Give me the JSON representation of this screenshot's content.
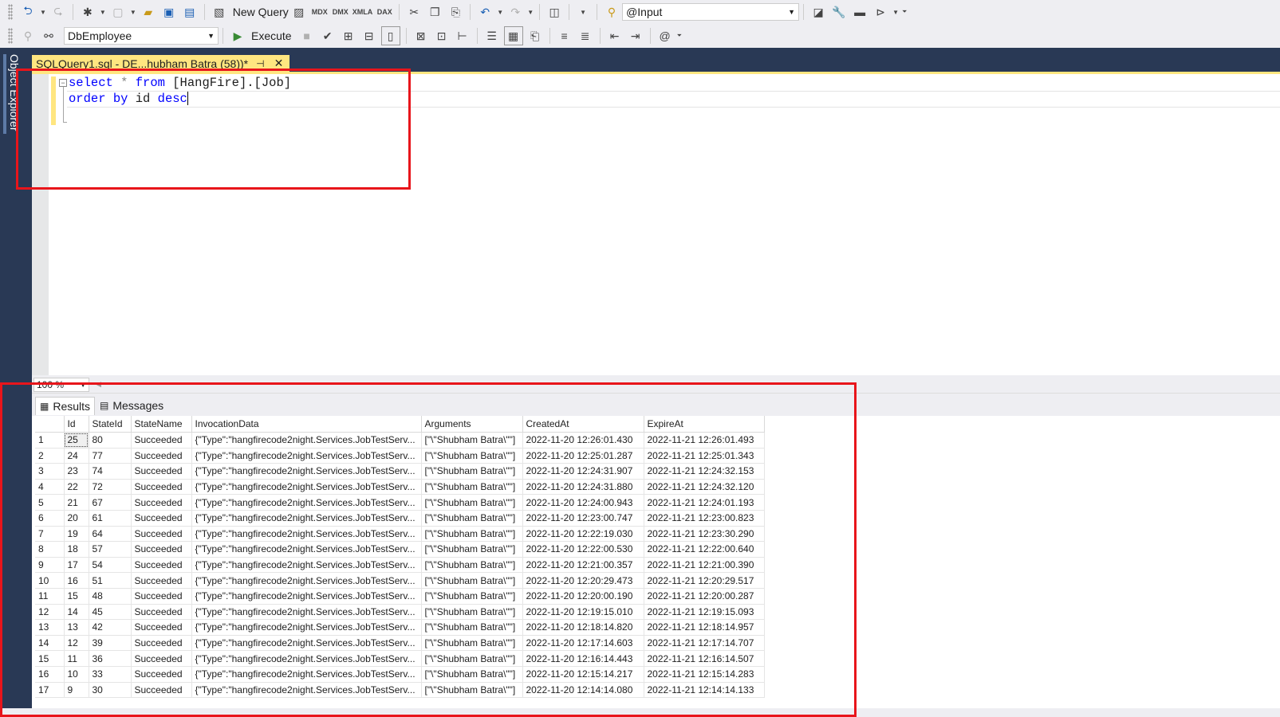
{
  "toolbar1": {
    "new_query_label": "New Query",
    "mdx_label": "MDX",
    "dmx_label": "DMX",
    "xmla_label": "XMLA",
    "dax_label": "DAX",
    "search_combo_value": "@Input"
  },
  "toolbar2": {
    "database_value": "DbEmployee",
    "execute_label": "Execute"
  },
  "object_explorer_label": "Object Explorer",
  "doc_tab": {
    "title": "SQLQuery1.sql - DE...hubham Batra (58))*",
    "pin_icon": "pin-icon",
    "close_icon": "close-icon"
  },
  "editor": {
    "line1": {
      "kw1": "select",
      "star": " * ",
      "kw2": "from",
      "rest": " [HangFire].[Job]"
    },
    "line2": {
      "kw1": "order",
      "sp1": " ",
      "kw2": "by",
      "mid": " id ",
      "kw3": "desc"
    }
  },
  "zoom": "100 %",
  "result_tabs": {
    "results": "Results",
    "messages": "Messages"
  },
  "grid": {
    "columns": [
      "Id",
      "StateId",
      "StateName",
      "InvocationData",
      "Arguments",
      "CreatedAt",
      "ExpireAt"
    ],
    "rows": [
      [
        "1",
        "25",
        "80",
        "Succeeded",
        "{\"Type\":\"hangfirecode2night.Services.JobTestServ...",
        "[\"\\\"Shubham Batra\\\"\"]",
        "2022-11-20 12:26:01.430",
        "2022-11-21 12:26:01.493"
      ],
      [
        "2",
        "24",
        "77",
        "Succeeded",
        "{\"Type\":\"hangfirecode2night.Services.JobTestServ...",
        "[\"\\\"Shubham Batra\\\"\"]",
        "2022-11-20 12:25:01.287",
        "2022-11-21 12:25:01.343"
      ],
      [
        "3",
        "23",
        "74",
        "Succeeded",
        "{\"Type\":\"hangfirecode2night.Services.JobTestServ...",
        "[\"\\\"Shubham Batra\\\"\"]",
        "2022-11-20 12:24:31.907",
        "2022-11-21 12:24:32.153"
      ],
      [
        "4",
        "22",
        "72",
        "Succeeded",
        "{\"Type\":\"hangfirecode2night.Services.JobTestServ...",
        "[\"\\\"Shubham Batra\\\"\"]",
        "2022-11-20 12:24:31.880",
        "2022-11-21 12:24:32.120"
      ],
      [
        "5",
        "21",
        "67",
        "Succeeded",
        "{\"Type\":\"hangfirecode2night.Services.JobTestServ...",
        "[\"\\\"Shubham Batra\\\"\"]",
        "2022-11-20 12:24:00.943",
        "2022-11-21 12:24:01.193"
      ],
      [
        "6",
        "20",
        "61",
        "Succeeded",
        "{\"Type\":\"hangfirecode2night.Services.JobTestServ...",
        "[\"\\\"Shubham Batra\\\"\"]",
        "2022-11-20 12:23:00.747",
        "2022-11-21 12:23:00.823"
      ],
      [
        "7",
        "19",
        "64",
        "Succeeded",
        "{\"Type\":\"hangfirecode2night.Services.JobTestServ...",
        "[\"\\\"Shubham Batra\\\"\"]",
        "2022-11-20 12:22:19.030",
        "2022-11-21 12:23:30.290"
      ],
      [
        "8",
        "18",
        "57",
        "Succeeded",
        "{\"Type\":\"hangfirecode2night.Services.JobTestServ...",
        "[\"\\\"Shubham Batra\\\"\"]",
        "2022-11-20 12:22:00.530",
        "2022-11-21 12:22:00.640"
      ],
      [
        "9",
        "17",
        "54",
        "Succeeded",
        "{\"Type\":\"hangfirecode2night.Services.JobTestServ...",
        "[\"\\\"Shubham Batra\\\"\"]",
        "2022-11-20 12:21:00.357",
        "2022-11-21 12:21:00.390"
      ],
      [
        "10",
        "16",
        "51",
        "Succeeded",
        "{\"Type\":\"hangfirecode2night.Services.JobTestServ...",
        "[\"\\\"Shubham Batra\\\"\"]",
        "2022-11-20 12:20:29.473",
        "2022-11-21 12:20:29.517"
      ],
      [
        "11",
        "15",
        "48",
        "Succeeded",
        "{\"Type\":\"hangfirecode2night.Services.JobTestServ...",
        "[\"\\\"Shubham Batra\\\"\"]",
        "2022-11-20 12:20:00.190",
        "2022-11-21 12:20:00.287"
      ],
      [
        "12",
        "14",
        "45",
        "Succeeded",
        "{\"Type\":\"hangfirecode2night.Services.JobTestServ...",
        "[\"\\\"Shubham Batra\\\"\"]",
        "2022-11-20 12:19:15.010",
        "2022-11-21 12:19:15.093"
      ],
      [
        "13",
        "13",
        "42",
        "Succeeded",
        "{\"Type\":\"hangfirecode2night.Services.JobTestServ...",
        "[\"\\\"Shubham Batra\\\"\"]",
        "2022-11-20 12:18:14.820",
        "2022-11-21 12:18:14.957"
      ],
      [
        "14",
        "12",
        "39",
        "Succeeded",
        "{\"Type\":\"hangfirecode2night.Services.JobTestServ...",
        "[\"\\\"Shubham Batra\\\"\"]",
        "2022-11-20 12:17:14.603",
        "2022-11-21 12:17:14.707"
      ],
      [
        "15",
        "11",
        "36",
        "Succeeded",
        "{\"Type\":\"hangfirecode2night.Services.JobTestServ...",
        "[\"\\\"Shubham Batra\\\"\"]",
        "2022-11-20 12:16:14.443",
        "2022-11-21 12:16:14.507"
      ],
      [
        "16",
        "10",
        "33",
        "Succeeded",
        "{\"Type\":\"hangfirecode2night.Services.JobTestServ...",
        "[\"\\\"Shubham Batra\\\"\"]",
        "2022-11-20 12:15:14.217",
        "2022-11-21 12:15:14.283"
      ],
      [
        "17",
        "9",
        "30",
        "Succeeded",
        "{\"Type\":\"hangfirecode2night.Services.JobTestServ...",
        "[\"\\\"Shubham Batra\\\"\"]",
        "2022-11-20 12:14:14.080",
        "2022-11-21 12:14:14.133"
      ]
    ]
  },
  "colors": {
    "annotation_red": "#e8151b",
    "tab_yellow": "#ffe680",
    "frame_navy": "#293955",
    "keyword_blue": "#0000ff"
  }
}
